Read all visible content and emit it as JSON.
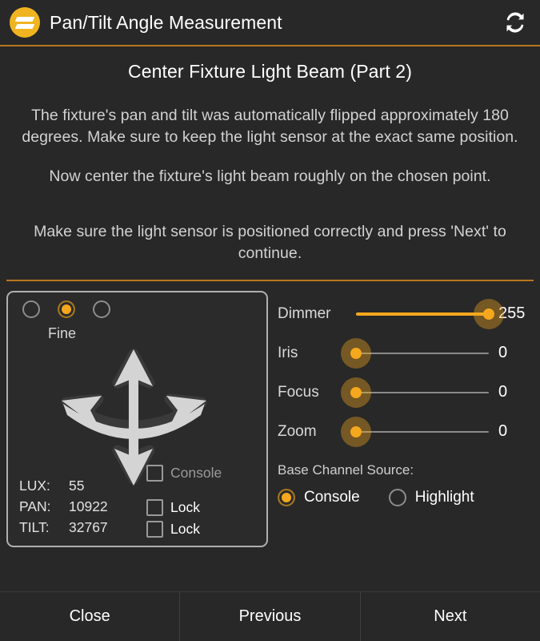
{
  "header": {
    "app_icon": "z-logo-icon",
    "title": "Pan/Tilt Angle Measurement",
    "refresh_icon": "refresh-icon",
    "accent_color": "#b9761c"
  },
  "instructions": {
    "step_title": "Center Fixture Light Beam (Part 2)",
    "paragraph_1": "The fixture's pan and tilt was automatically flipped approximately 180 degrees. Make sure to keep the light sensor at the exact same position.",
    "paragraph_2": "Now center the fixture's light beam roughly on the chosen point.",
    "paragraph_3": "Make sure the light sensor is positioned correctly and press 'Next' to continue."
  },
  "control_panel": {
    "mode_radios": [
      {
        "name": "coarse",
        "selected": false
      },
      {
        "name": "fine",
        "selected": true
      },
      {
        "name": "ultra",
        "selected": false
      }
    ],
    "mode_label": "Fine",
    "joystick_icon": "pan-tilt-joystick-icon",
    "readouts": [
      {
        "key": "LUX:",
        "value": "55"
      },
      {
        "key": "PAN:",
        "value": "10922"
      },
      {
        "key": "TILT:",
        "value": "32767"
      }
    ],
    "checkboxes": [
      {
        "label": "Console",
        "checked": false,
        "dim": true
      },
      {
        "label": "Lock",
        "checked": false,
        "dim": false
      },
      {
        "label": "Lock",
        "checked": false,
        "dim": false
      }
    ]
  },
  "sliders": [
    {
      "label": "Dimmer",
      "value": "255",
      "percent": 100
    },
    {
      "label": "Iris",
      "value": "0",
      "percent": 0
    },
    {
      "label": "Focus",
      "value": "0",
      "percent": 0
    },
    {
      "label": "Zoom",
      "value": "0",
      "percent": 0
    }
  ],
  "base_channel_source": {
    "title": "Base Channel Source:",
    "options": [
      {
        "label": "Console",
        "selected": true
      },
      {
        "label": "Highlight",
        "selected": false
      }
    ]
  },
  "footer": {
    "buttons": [
      {
        "label": "Close"
      },
      {
        "label": "Previous"
      },
      {
        "label": "Next"
      }
    ]
  },
  "colors": {
    "background": "#282828",
    "accent_orange": "#f5a71d",
    "divider_orange": "#b9761c",
    "panel_border": "#b0b0b0"
  }
}
